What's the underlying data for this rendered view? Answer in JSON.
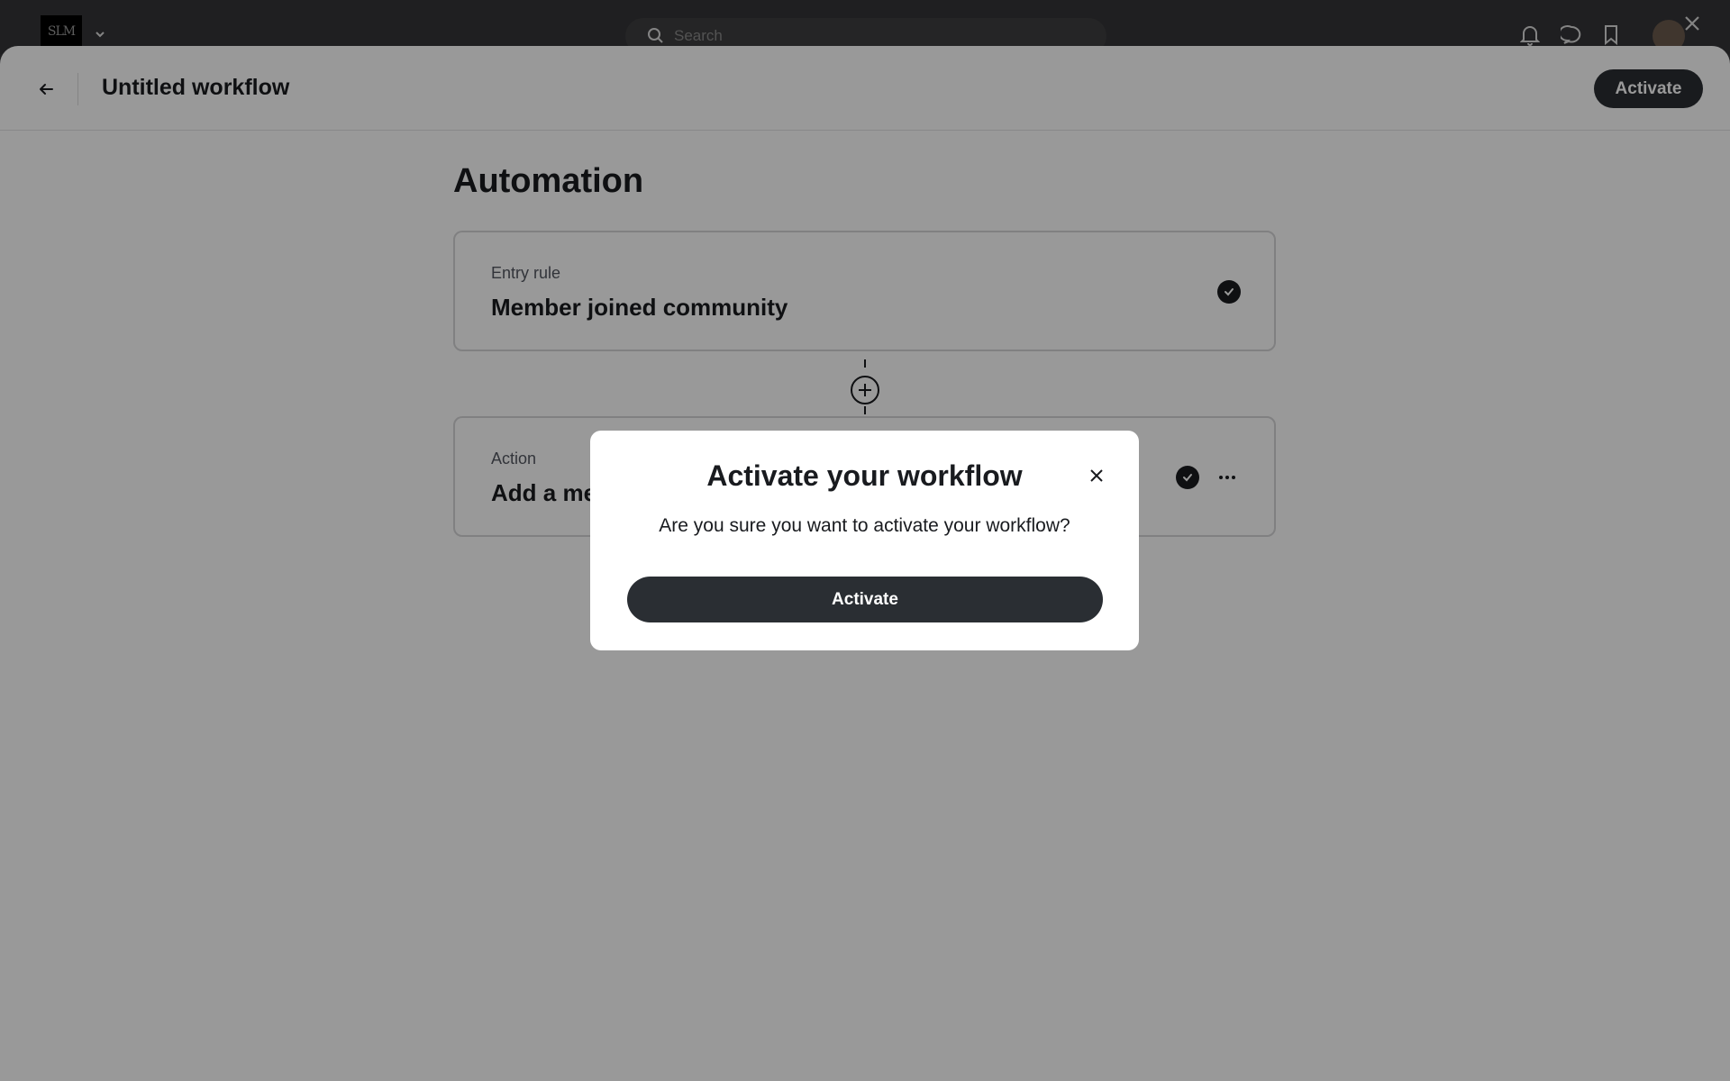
{
  "app": {
    "logo_text": "SLM",
    "search_placeholder": "Search"
  },
  "workflow": {
    "title": "Untitled workflow",
    "activate_label": "Activate"
  },
  "main": {
    "section_title": "Automation",
    "entry_rule": {
      "label": "Entry rule",
      "value": "Member joined community"
    },
    "action": {
      "label": "Action",
      "value": "Add a me"
    }
  },
  "modal": {
    "title": "Activate your workflow",
    "message": "Are you sure you want to activate your workflow?",
    "confirm_label": "Activate"
  },
  "icons": {
    "back": "arrow-left-icon",
    "close": "close-icon",
    "check": "check-circle-icon",
    "more": "more-horizontal-icon",
    "add": "plus-circle-icon",
    "search": "search-icon",
    "bell": "bell-icon",
    "chat": "chat-icon",
    "bookmark": "bookmark-icon"
  },
  "colors": {
    "primary_button": "#2a2e33",
    "text": "#191b1f",
    "overlay": "rgba(0,0,0,0.4)"
  }
}
